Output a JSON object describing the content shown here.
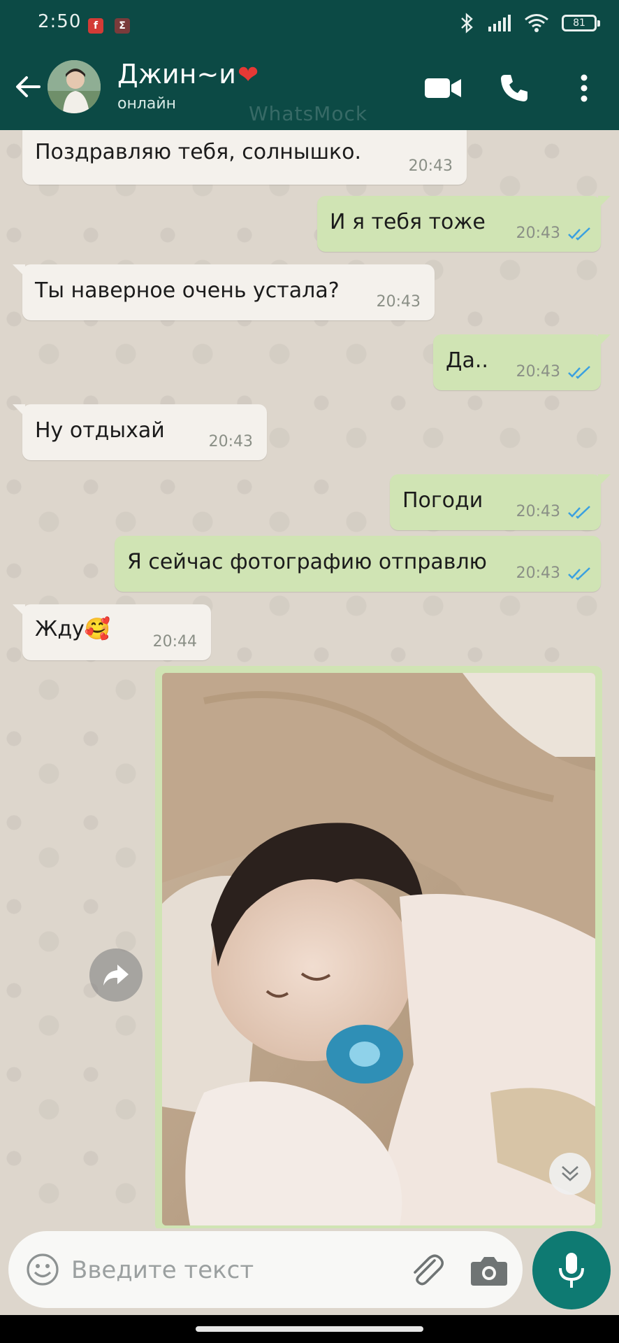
{
  "status_bar": {
    "time": "2:50",
    "battery": "81",
    "notif_1": "f",
    "notif_2": "Σ"
  },
  "header": {
    "contact_name": "Джин~и",
    "heart": "❤",
    "status": "онлайн",
    "watermark": "WhatsMock"
  },
  "messages": [
    {
      "dir": "in",
      "text": "Поздравляю тебя, солнышко.",
      "time": "20:43"
    },
    {
      "dir": "out",
      "text": "И я тебя тоже",
      "time": "20:43",
      "read": true
    },
    {
      "dir": "in",
      "text": "Ты наверное очень устала?",
      "time": "20:43"
    },
    {
      "dir": "out",
      "text": "Да..",
      "time": "20:43",
      "read": true
    },
    {
      "dir": "in",
      "text": "Ну отдыхай",
      "time": "20:43"
    },
    {
      "dir": "out",
      "text": "Погоди",
      "time": "20:43",
      "read": true
    },
    {
      "dir": "out",
      "text": "Я сейчас фотографию отправлю",
      "time": "20:43",
      "read": true
    },
    {
      "dir": "in",
      "text": "Жду🥰",
      "time": "20:44"
    }
  ],
  "composer": {
    "placeholder": "Введите текст"
  },
  "colors": {
    "header": "#0c4a45",
    "incoming_bubble": "#f4f1ec",
    "outgoing_bubble": "#d0e4b4",
    "read_ticks": "#3aa0e0",
    "mic_button": "#0e7a72"
  }
}
